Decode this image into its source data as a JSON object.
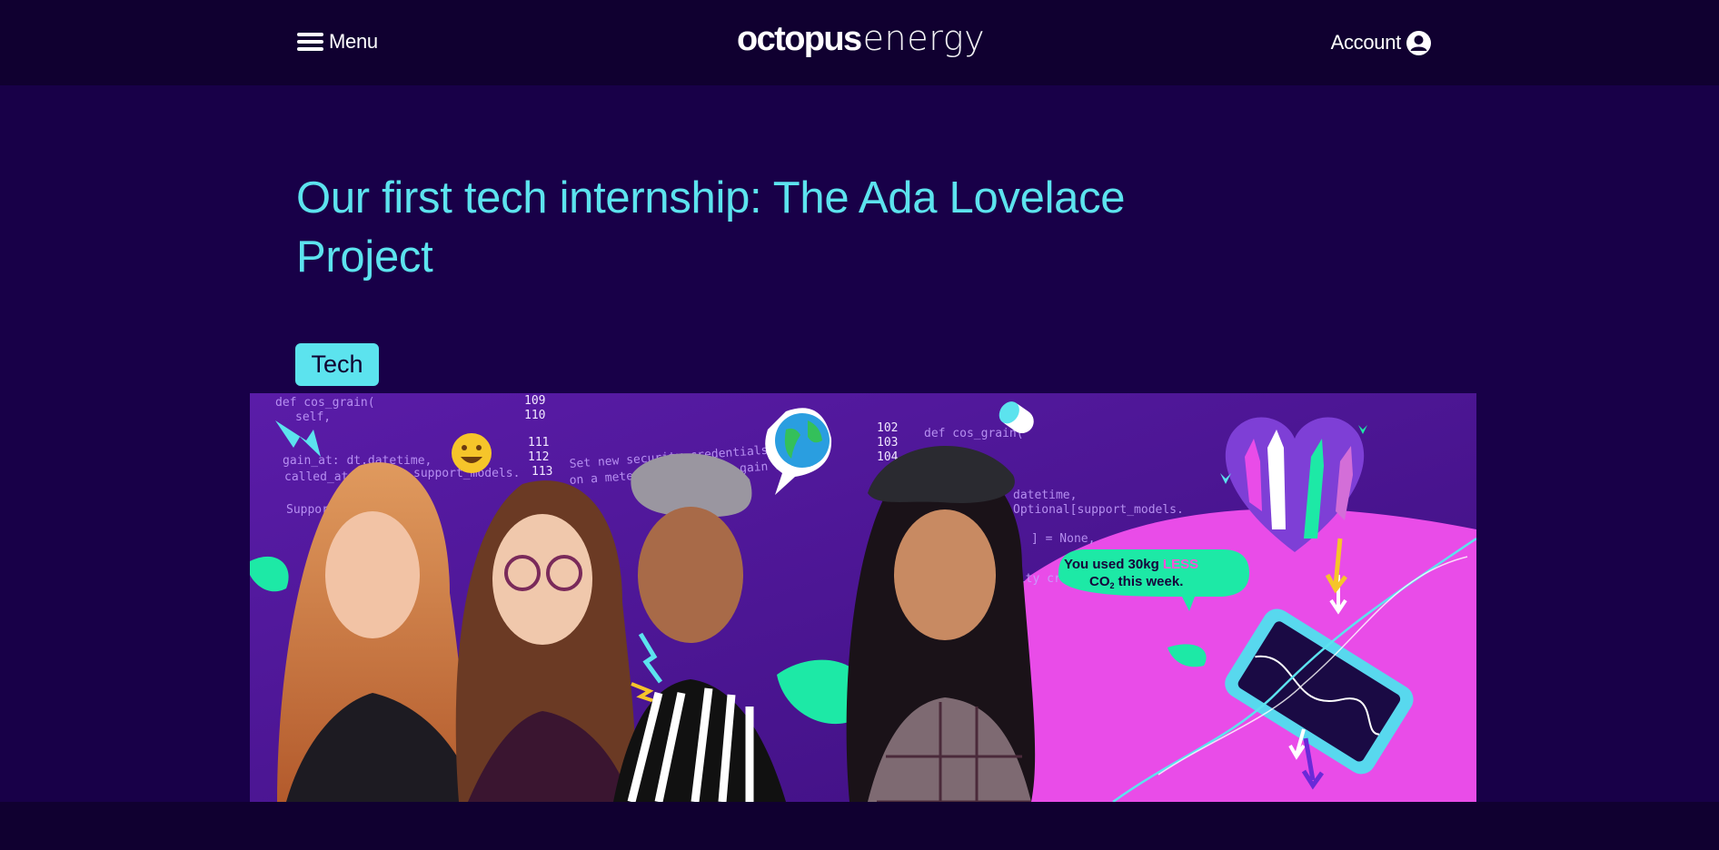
{
  "header": {
    "menu_label": "Menu",
    "logo_bold": "octopus",
    "logo_thin": "energy",
    "account_label": "Account"
  },
  "article": {
    "title": "Our first tech internship: The Ada Lovelace Project",
    "tag": "Tech"
  },
  "hero": {
    "bubble_line1_pre": "You used 30kg ",
    "bubble_line1_highlight": "LESS",
    "bubble_line2_a": "CO",
    "bubble_line2_sub": "2",
    "bubble_line2_b": " this week.",
    "code_lines": [
      "def cos_grain(",
      "self,",
      "gain_at: dt.datetime,",
      "called_at",
      "support_models.",
      "SupportUser] = None.",
      "Set new security credentials and con",
      "on a meter that we have gain supp",
      "Optional[support_models.",
      "] = None,",
      "def cos_grain(",
      "datetime,",
      "rity cre"
    ],
    "line_numbers_a": [
      "109",
      "110",
      "111",
      "112",
      "113"
    ],
    "line_numbers_b": [
      "102",
      "103",
      "104"
    ],
    "colors": {
      "bubble_bg": "#1de9a6",
      "highlight": "#ff4fd8",
      "pink_bg": "#e94ce8",
      "phone": "#58d8ee"
    }
  }
}
